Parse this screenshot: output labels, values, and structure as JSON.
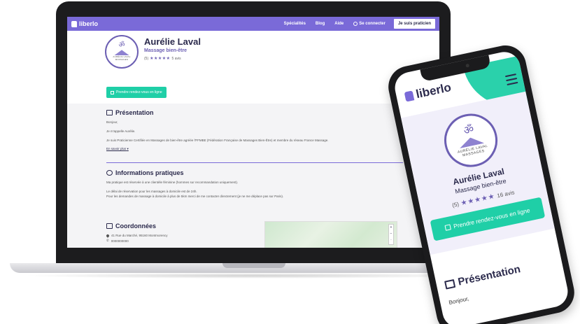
{
  "desktop": {
    "nav": {
      "logo": "liberlo",
      "links": [
        "Spécialités",
        "Blog",
        "Aide"
      ],
      "login": "Se connecter",
      "pro_button": "Je suis praticien"
    },
    "profile": {
      "name": "Aurélie Laval",
      "specialty": "Massage bien-être",
      "rating_count": "(5)",
      "stars": "★★★★★",
      "reviews": "5 avis",
      "avatar_caption": "AURÉLIE LAVAL MASSAGES",
      "book_button": "Prendre rendez-vous en ligne"
    },
    "presentation": {
      "title": "Présentation",
      "greeting": "Bonjour,",
      "intro": "Je m'appelle Aurélie.",
      "body": "Je suis Praticienne Certifiée en Massages de bien-être agréée l'FFMBE (Fédération Française de Massages Bien-Être) et membre du réseau France Massage.",
      "more_link": "En savoir plus"
    },
    "info": {
      "title": "Informations pratiques",
      "line1": "Ma pratique est réservée à une clientèle féminine (hommes sur recommandation uniquement).",
      "line2": "Le délai de réservation pour les massages à domicile est de 24h.",
      "line3": "Pour les demandes de massage à domicile à plus de 5km merci de me contacter directement (je ne me déplace pas sur Paris)."
    },
    "contact": {
      "title": "Coordonnées",
      "address": "41 Rue du Marché, 95160 Montmorency",
      "phone": "0000000000"
    }
  },
  "mobile": {
    "logo": "liberlo",
    "name": "Aurélie Laval",
    "specialty": "Massage bien-être",
    "rating_count": "(5)",
    "stars": "★★★★★",
    "reviews": "16 avis",
    "avatar_caption": "AURÉLIE LAVAL MASSAGES",
    "book_button": "Prendre rendez-vous en ligne",
    "section_title": "Présentation",
    "greeting": "Bonjour,"
  },
  "colors": {
    "brand": "#7a6ad8",
    "accent": "#1fcfa7",
    "text": "#2b2a4c"
  }
}
